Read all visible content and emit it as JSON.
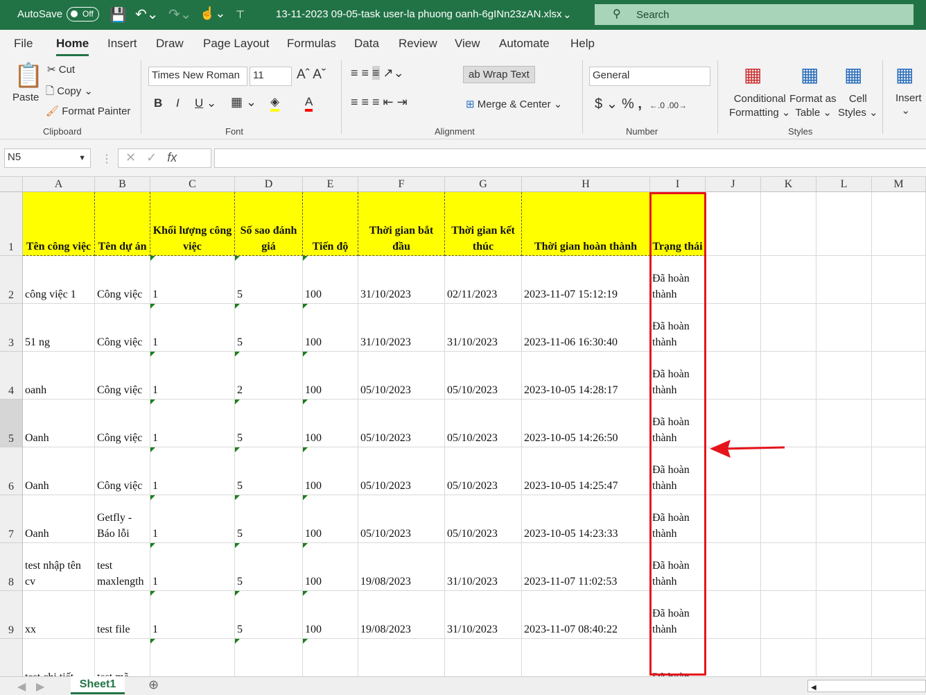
{
  "titlebar": {
    "autosave_label": "AutoSave",
    "autosave_state": "Off",
    "filename": "13-11-2023 09-05-task user-la phuong oanh-6gINn23zAN.xlsx",
    "search_placeholder": "Search"
  },
  "tabs": [
    "File",
    "Home",
    "Insert",
    "Draw",
    "Page Layout",
    "Formulas",
    "Data",
    "Review",
    "View",
    "Automate",
    "Help"
  ],
  "active_tab": "Home",
  "ribbon": {
    "clipboard": {
      "paste": "Paste",
      "cut": "Cut",
      "copy": "Copy",
      "format_painter": "Format Painter",
      "group": "Clipboard"
    },
    "font": {
      "name": "Times New Roman",
      "size": "11",
      "group": "Font",
      "fill_color": "#ffff00",
      "font_color": "#ff0000"
    },
    "alignment": {
      "wrap_text": "Wrap Text",
      "merge_center": "Merge & Center",
      "group": "Alignment"
    },
    "number": {
      "format": "General",
      "group": "Number"
    },
    "styles": {
      "conditional_1": "Conditional",
      "conditional_2": "Formatting",
      "format_as_1": "Format as",
      "format_as_2": "Table",
      "cell_1": "Cell",
      "cell_2": "Styles",
      "group": "Styles"
    },
    "cells": {
      "insert": "Insert"
    }
  },
  "formula_bar": {
    "name_box": "N5",
    "formula": ""
  },
  "columns": [
    "A",
    "B",
    "C",
    "D",
    "E",
    "F",
    "G",
    "H",
    "I",
    "J",
    "K",
    "L",
    "M"
  ],
  "header_row": [
    "Tên công việc",
    "Tên dự án",
    "Khối lượng công việc",
    "Số sao đánh giá",
    "Tiến độ",
    "Thời gian bắt đầu",
    "Thời gian kết thúc",
    "Thời gian hoàn thành",
    "Trạng thái"
  ],
  "rows": [
    {
      "num": "1"
    },
    {
      "num": "2",
      "cells": [
        "công việc 1",
        "Công việc",
        "1",
        "5",
        "100",
        "31/10/2023",
        "02/11/2023",
        "2023-11-07 15:12:19",
        "Đã hoàn thành"
      ]
    },
    {
      "num": "3",
      "cells": [
        "51 ng",
        "Công việc",
        "1",
        "5",
        "100",
        "31/10/2023",
        "31/10/2023",
        "2023-11-06 16:30:40",
        "Đã hoàn thành"
      ]
    },
    {
      "num": "4",
      "cells": [
        "oanh",
        "Công việc",
        "1",
        "2",
        "100",
        "05/10/2023",
        "05/10/2023",
        "2023-10-05 14:28:17",
        "Đã hoàn thành"
      ]
    },
    {
      "num": "5",
      "cells": [
        "Oanh",
        "Công việc",
        "1",
        "5",
        "100",
        "05/10/2023",
        "05/10/2023",
        "2023-10-05 14:26:50",
        "Đã hoàn thành"
      ]
    },
    {
      "num": "6",
      "cells": [
        "Oanh",
        "Công việc",
        "1",
        "5",
        "100",
        "05/10/2023",
        "05/10/2023",
        "2023-10-05 14:25:47",
        "Đã hoàn thành"
      ]
    },
    {
      "num": "7",
      "cells": [
        "Oanh",
        "Getfly - Báo lỗi",
        "1",
        "5",
        "100",
        "05/10/2023",
        "05/10/2023",
        "2023-10-05 14:23:33",
        "Đã hoàn thành"
      ]
    },
    {
      "num": "8",
      "cells": [
        "test nhập tên cv",
        "test maxlength",
        "1",
        "5",
        "100",
        "19/08/2023",
        "31/10/2023",
        "2023-11-07 11:02:53",
        "Đã hoàn thành"
      ]
    },
    {
      "num": "9",
      "cells": [
        "xx",
        "test file",
        "1",
        "5",
        "100",
        "19/08/2023",
        "31/10/2023",
        "2023-11-07 08:40:22",
        "Đã hoàn thành"
      ]
    },
    {
      "num": "",
      "cells": [
        "test chi tiết",
        "test mã",
        "",
        "",
        "",
        "",
        "",
        "",
        "Đã hoàn"
      ]
    }
  ],
  "sheets": [
    "Sheet1"
  ],
  "annotation": {
    "color": "#e5141b"
  }
}
